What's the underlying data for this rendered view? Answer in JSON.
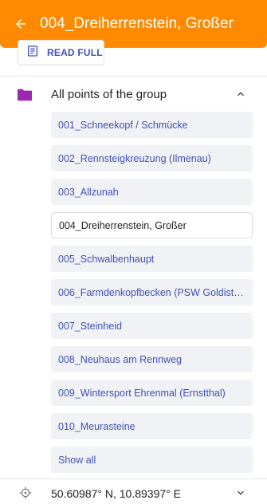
{
  "header": {
    "title": "004_Dreiherrenstein, Großer",
    "background": "#ff8a00"
  },
  "read_full": {
    "label": "READ FULL",
    "icon": "document-icon"
  },
  "group": {
    "label": "All points of the group",
    "icon": "folder-icon",
    "folder_color": "#9c27b0",
    "expanded": true
  },
  "points": [
    {
      "label": "001_Schneekopf / Schmücke",
      "active": false
    },
    {
      "label": "002_Rennsteigkreuzung (Ilmenau)",
      "active": false
    },
    {
      "label": "003_Allzunah",
      "active": false
    },
    {
      "label": "004_Dreiherrenstein, Großer",
      "active": true
    },
    {
      "label": "005_Schwalbenhaupt",
      "active": false
    },
    {
      "label": "006_Farmdenkopfbecken (PSW Goldisth…",
      "active": false
    },
    {
      "label": "007_Steinheid",
      "active": false
    },
    {
      "label": "008_Neuhaus am Rennweg",
      "active": false
    },
    {
      "label": "009_Wintersport Ehrenmal (Ernstthal)",
      "active": false
    },
    {
      "label": "010_Meurasteine",
      "active": false
    }
  ],
  "show_all": {
    "label": "Show all"
  },
  "coordinates": {
    "label": "50.60987° N, 10.89397° E",
    "icon": "location-target-icon"
  },
  "colors": {
    "link": "#3f51b5",
    "item_bg": "#f1f2f5"
  }
}
